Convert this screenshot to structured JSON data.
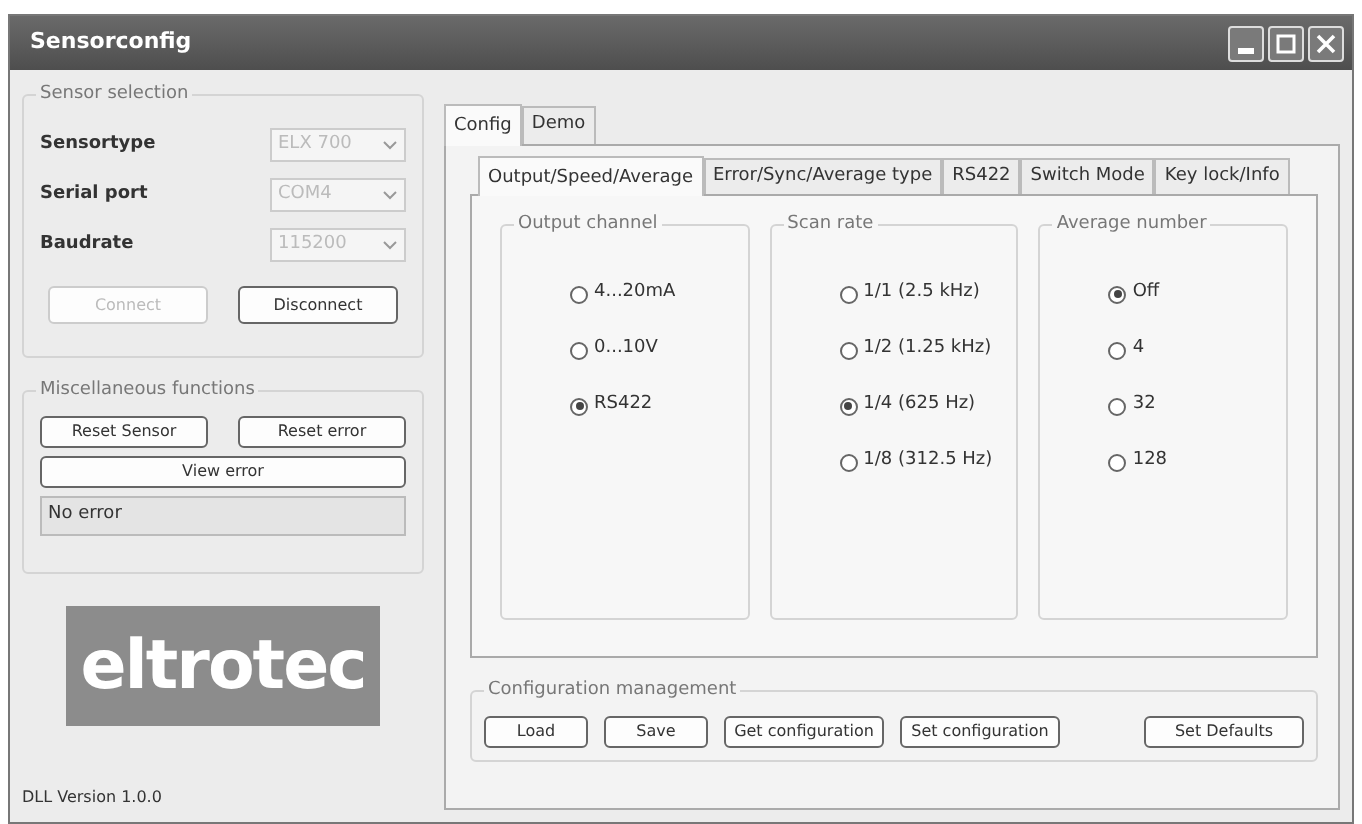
{
  "window": {
    "title": "Sensorconfig"
  },
  "sensor_selection": {
    "title": "Sensor selection",
    "fields": [
      {
        "label": "Sensortype",
        "value": "ELX 700",
        "disabled": true
      },
      {
        "label": "Serial port",
        "value": "COM4",
        "disabled": true
      },
      {
        "label": "Baudrate",
        "value": "115200",
        "disabled": true
      }
    ],
    "buttons": [
      {
        "label": "Connect",
        "disabled": true
      },
      {
        "label": "Disconnect",
        "disabled": false
      }
    ]
  },
  "misc": {
    "title": "Miscellaneous functions",
    "buttons": [
      {
        "label": "Reset Sensor"
      },
      {
        "label": "Reset error"
      }
    ],
    "wide_button": {
      "label": "View error"
    },
    "error_field": {
      "value": "No error"
    }
  },
  "logo": {
    "text": "eltrotec"
  },
  "status": "DLL Version 1.0.0",
  "tabs": [
    {
      "label": "Config",
      "selected": true
    },
    {
      "label": "Demo",
      "selected": false
    }
  ],
  "subtabs": [
    {
      "label": "Output/Speed/Average",
      "selected": true
    },
    {
      "label": "Error/Sync/Average type",
      "selected": false
    },
    {
      "label": "RS422",
      "selected": false
    },
    {
      "label": "Switch Mode",
      "selected": false
    },
    {
      "label": "Key lock/Info",
      "selected": false
    }
  ],
  "groups": [
    {
      "title": "Output channel",
      "options": [
        {
          "label": "4...20mA",
          "selected": false
        },
        {
          "label": "0...10V",
          "selected": false
        },
        {
          "label": "RS422",
          "selected": true
        }
      ]
    },
    {
      "title": "Scan rate",
      "options": [
        {
          "label": "1/1 (2.5 kHz)",
          "selected": false
        },
        {
          "label": "1/2 (1.25 kHz)",
          "selected": false
        },
        {
          "label": "1/4 (625 Hz)",
          "selected": true
        },
        {
          "label": "1/8 (312.5 Hz)",
          "selected": false
        }
      ]
    },
    {
      "title": "Average number",
      "options": [
        {
          "label": "Off",
          "selected": true
        },
        {
          "label": "4",
          "selected": false
        },
        {
          "label": "32",
          "selected": false
        },
        {
          "label": "128",
          "selected": false
        }
      ]
    }
  ],
  "config_management": {
    "title": "Configuration management",
    "buttons": [
      {
        "label": "Load"
      },
      {
        "label": "Save"
      },
      {
        "label": "Get configuration"
      },
      {
        "label": "Set configuration"
      },
      {
        "label": "Set Defaults"
      }
    ]
  }
}
